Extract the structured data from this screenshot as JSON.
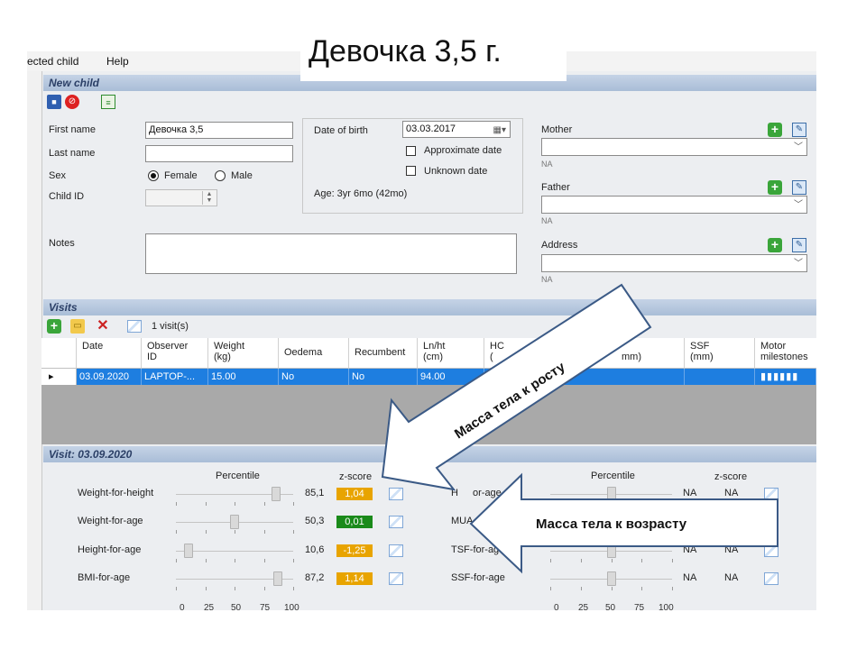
{
  "title": "Девочка 3,5 г.",
  "menu": [
    "ected child",
    "Help"
  ],
  "new_child": {
    "header": "New child",
    "labels": {
      "first_name": "First name",
      "last_name": "Last name",
      "sex": "Sex",
      "child_id": "Child ID",
      "notes": "Notes",
      "date_of_birth": "Date of birth",
      "approximate_date": "Approximate date",
      "unknown_date": "Unknown date",
      "mother": "Mother",
      "father": "Father",
      "address": "Address",
      "female": "Female",
      "male": "Male"
    },
    "first_name": "Девочка 3,5",
    "last_name": "",
    "sex": "Female",
    "dob": "03.03.2017",
    "age": "Age: 3yr 6mo (42mo)",
    "na": "NA"
  },
  "visits": {
    "header": "Visits",
    "count": "1 visit(s)",
    "columns": [
      "Date",
      "Observer\nID",
      "Weight\n(kg)",
      "Oedema",
      "Recumbent",
      "Ln/ht\n(cm)",
      "HC\n(",
      "mm)",
      "SSF\n(mm)",
      "Motor\nmilestones"
    ],
    "row": [
      "03.09.2020",
      "LAPTOP-...",
      "15.00",
      "No",
      "No",
      "94.00"
    ]
  },
  "visit_detail": {
    "header": "Visit: 03.09.2020",
    "percentile_label": "Percentile",
    "zscore_label": "z-score",
    "left": [
      {
        "name": "Weight-for-height",
        "percentile": "85,1",
        "z": "1,04",
        "z_color": "#e8a400",
        "pos": 0.851
      },
      {
        "name": "Weight-for-age",
        "percentile": "50,3",
        "z": "0,01",
        "z_color": "#1a8a1a",
        "pos": 0.503
      },
      {
        "name": "Height-for-age",
        "percentile": "10,6",
        "z": "-1,25",
        "z_color": "#e8a400",
        "pos": 0.106
      },
      {
        "name": "BMI-for-age",
        "percentile": "87,2",
        "z": "1,14",
        "z_color": "#e8a400",
        "pos": 0.872
      }
    ],
    "right": [
      {
        "name": "H",
        "suffix": "or-age",
        "p": "NA",
        "z": "NA"
      },
      {
        "name": "MUA",
        "suffix": "",
        "p": "NA",
        "z": "NA"
      },
      {
        "name": "TSF-for-ag",
        "suffix": "",
        "p": "NA",
        "z": "NA"
      },
      {
        "name": "SSF-for-age",
        "suffix": "",
        "p": "NA",
        "z": "NA"
      }
    ],
    "scale": [
      "0",
      "25",
      "50",
      "75",
      "100"
    ]
  },
  "annotations": {
    "arrow1": "Масса тела к росту",
    "arrow2": "Масса тела к возрасту"
  }
}
